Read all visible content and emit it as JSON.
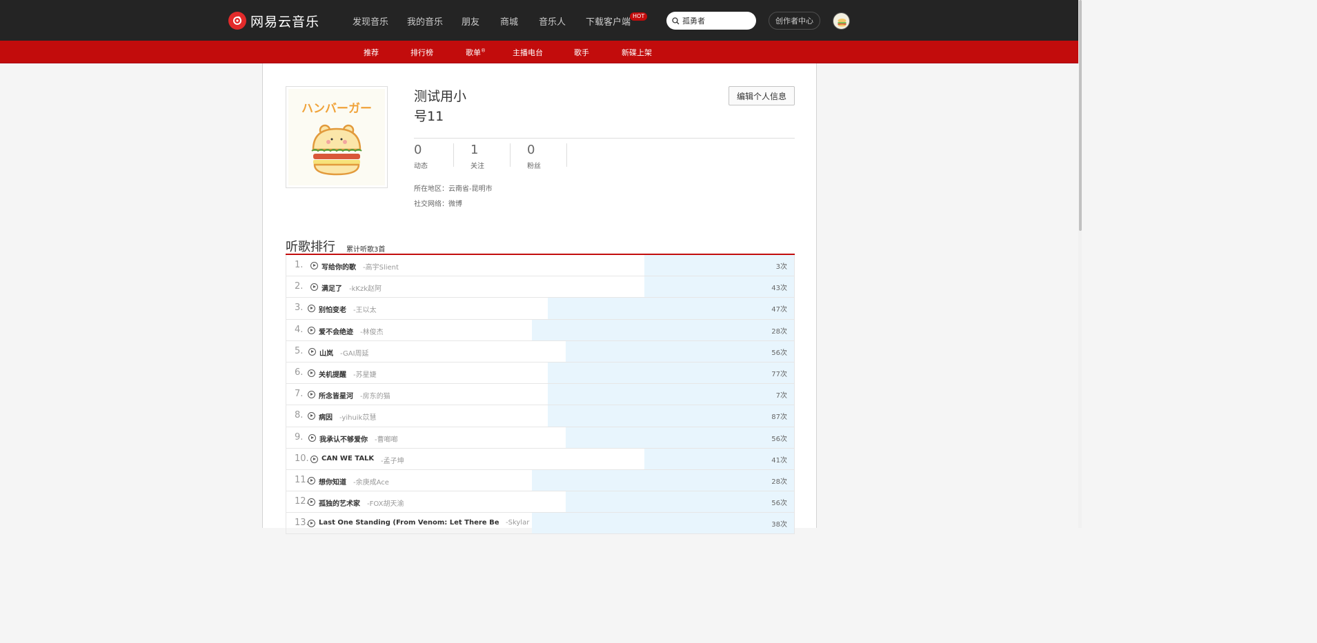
{
  "header": {
    "brand": "网易云音乐",
    "nav": [
      "发现音乐",
      "我的音乐",
      "朋友",
      "商城",
      "音乐人",
      "下载客户端"
    ],
    "hot_badge": "HOT",
    "search_value": "孤勇者",
    "creator_center": "创作者中心"
  },
  "subnav": {
    "items": [
      "推荐",
      "排行榜",
      "歌单",
      "主播电台",
      "歌手",
      "新碟上架"
    ],
    "playlist_mark": "®"
  },
  "profile": {
    "name_line1": "测试用小",
    "name_line2": "号11",
    "edit_button": "编辑个人信息",
    "stats": [
      {
        "value": "0",
        "label": "动态"
      },
      {
        "value": "1",
        "label": "关注"
      },
      {
        "value": "0",
        "label": "粉丝"
      }
    ],
    "region": "所在地区：云南省-昆明市",
    "social": "社交网络：微博",
    "avatar_icon": "hamburger-bear-avatar"
  },
  "ranking": {
    "title": "听歌排行",
    "subtitle": "累计听歌3首",
    "items": [
      {
        "rank": "1.",
        "title": "写给你的歌",
        "artist": "-高宇Slient",
        "count": "3次",
        "fill": 0.295
      },
      {
        "rank": "2.",
        "title": "满足了",
        "artist": "-kKzk赵阿",
        "count": "43次",
        "fill": 0.295
      },
      {
        "rank": "3.",
        "title": "别怕变老",
        "artist": "-王以太",
        "count": "47次",
        "fill": 0.485
      },
      {
        "rank": "4.",
        "title": "爱不会绝迹",
        "artist": "-林俊杰",
        "count": "28次",
        "fill": 0.516
      },
      {
        "rank": "5.",
        "title": "山岚",
        "artist": "-GAI周延",
        "count": "56次",
        "fill": 0.45
      },
      {
        "rank": "6.",
        "title": "关机提醒",
        "artist": "-苏星婕",
        "count": "77次",
        "fill": 0.485
      },
      {
        "rank": "7.",
        "title": "所念皆星河",
        "artist": "-房东的猫",
        "count": "7次",
        "fill": 0.485
      },
      {
        "rank": "8.",
        "title": "病因",
        "artist": "-yihuik苡慧",
        "count": "87次",
        "fill": 0.485
      },
      {
        "rank": "9.",
        "title": "我承认不够爱你",
        "artist": "-曹啷啷",
        "count": "56次",
        "fill": 0.45
      },
      {
        "rank": "10.",
        "title": "CAN WE TALK",
        "artist": "-孟子坤",
        "count": "41次",
        "fill": 0.295
      },
      {
        "rank": "11.",
        "title": "想你知道",
        "artist": "-余庚成Ace",
        "count": "28次",
        "fill": 0.516
      },
      {
        "rank": "12.",
        "title": "孤独的艺术家",
        "artist": "-FOX胡天渝",
        "count": "56次",
        "fill": 0.45
      },
      {
        "rank": "13.",
        "title": "Last One Standing (From Venom: Let There Be",
        "artist": "-Skylar",
        "count": "38次",
        "fill": 0.516
      }
    ]
  },
  "colors": {
    "brand_red": "#c20c0c",
    "topbar": "#242424",
    "fill_blue": "#e8f5fd"
  }
}
